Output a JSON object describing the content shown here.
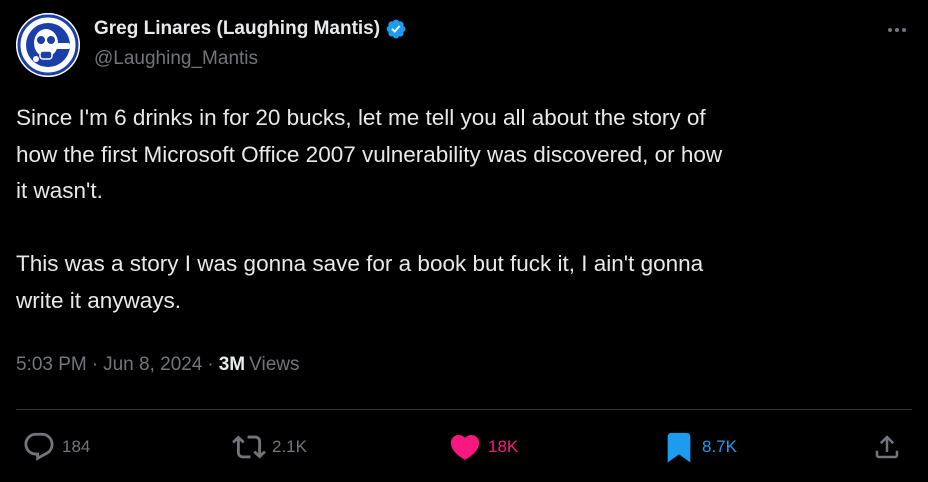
{
  "author": {
    "display_name": "Greg Linares (Laughing Mantis)",
    "handle": "@Laughing_Mantis",
    "verified": true
  },
  "tweet": {
    "text": "Since I'm 6 drinks in for 20 bucks, let me tell you all about the story of\nhow the first Microsoft Office 2007 vulnerability was discovered, or how\nit wasn't.\n\nThis was a story I was gonna save for a book but fuck it, I ain't gonna\nwrite it anyways.",
    "time": "5:03 PM",
    "date": "Jun 8, 2024",
    "separator": "·",
    "views_count": "3M",
    "views_label": "Views"
  },
  "actions": {
    "reply_count": "184",
    "retweet_count": "2.1K",
    "like_count": "18K",
    "bookmark_count": "8.7K"
  },
  "colors": {
    "background": "#000000",
    "text": "#e7e9ea",
    "muted": "#71767b",
    "verified_blue": "#1d9bf0",
    "like_pink": "#f91880",
    "bookmark_blue": "#1d9bf0",
    "divider": "#2f3336"
  },
  "icons": {
    "more": "more-horizontal-icon",
    "reply": "reply-icon",
    "retweet": "retweet-icon",
    "like": "heart-icon",
    "bookmark": "bookmark-icon",
    "share": "share-icon",
    "verified": "verified-badge-icon"
  }
}
